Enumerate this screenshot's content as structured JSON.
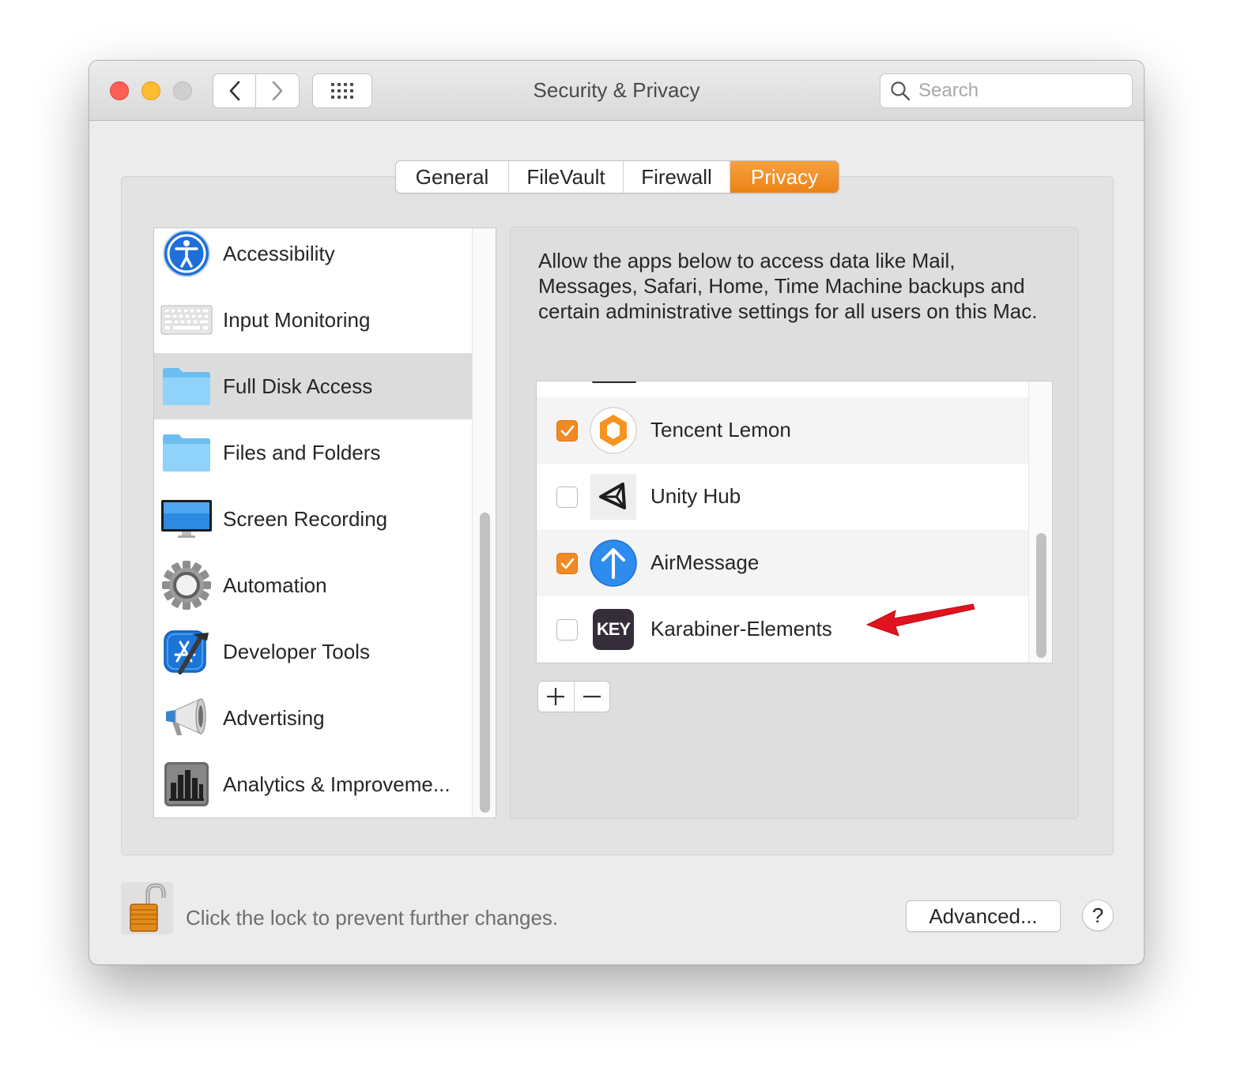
{
  "window": {
    "title": "Security & Privacy"
  },
  "search": {
    "placeholder": "Search"
  },
  "tabs": [
    {
      "label": "General",
      "active": false
    },
    {
      "label": "FileVault",
      "active": false
    },
    {
      "label": "Firewall",
      "active": false
    },
    {
      "label": "Privacy",
      "active": true
    }
  ],
  "categories": [
    {
      "label": "Accessibility",
      "icon": "accessibility-icon"
    },
    {
      "label": "Input Monitoring",
      "icon": "keyboard-icon"
    },
    {
      "label": "Full Disk Access",
      "icon": "folder-icon",
      "selected": true
    },
    {
      "label": "Files and Folders",
      "icon": "folder-icon"
    },
    {
      "label": "Screen Recording",
      "icon": "display-icon"
    },
    {
      "label": "Automation",
      "icon": "gear-icon"
    },
    {
      "label": "Developer Tools",
      "icon": "xcode-icon"
    },
    {
      "label": "Advertising",
      "icon": "megaphone-icon"
    },
    {
      "label": "Analytics & Improveme...",
      "icon": "bar-chart-icon"
    }
  ],
  "detail": {
    "description": "Allow the apps below to access data like Mail, Messages, Safari, Home, Time Machine backups and certain administrative settings for all users on this Mac."
  },
  "apps": [
    {
      "name": "Tencent Lemon",
      "checked": true,
      "icon": "tencent-lemon-icon"
    },
    {
      "name": "Unity Hub",
      "checked": false,
      "icon": "unity-icon"
    },
    {
      "name": "AirMessage",
      "checked": true,
      "icon": "airmessage-icon"
    },
    {
      "name": "Karabiner-Elements",
      "checked": false,
      "icon": "karabiner-icon",
      "icon_text": "KEY"
    }
  ],
  "footer": {
    "lock_text": "Click the lock to prevent further changes.",
    "advanced_label": "Advanced...",
    "help_label": "?"
  },
  "colors": {
    "accent": "#f08a24",
    "annotation_arrow": "#e0141e"
  }
}
